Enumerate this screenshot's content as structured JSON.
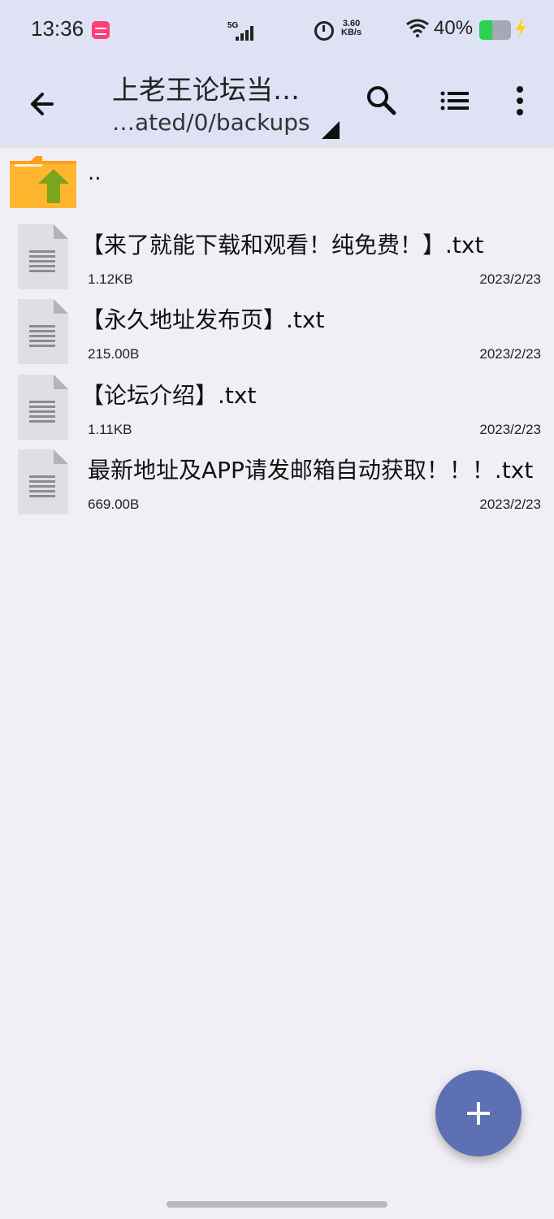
{
  "status_bar": {
    "time": "13:36",
    "net_speed_top": "3.60",
    "net_speed_bottom": "KB/s",
    "network_type": "5G",
    "battery_percent": "40%",
    "battery_level": 0.4
  },
  "app_bar": {
    "title": "上老王论坛当…",
    "path": "…ated/0/backups"
  },
  "parent_directory": "..",
  "files": [
    {
      "name": "【来了就能下载和观看！纯免费！】.txt",
      "size": "1.12KB",
      "date": "2023/2/23"
    },
    {
      "name": "【永久地址发布页】.txt",
      "size": "215.00B",
      "date": "2023/2/23"
    },
    {
      "name": "【论坛介绍】.txt",
      "size": "1.11KB",
      "date": "2023/2/23"
    },
    {
      "name": "最新地址及APP请发邮箱自动获取！！！.txt",
      "size": "669.00B",
      "date": "2023/2/23"
    }
  ],
  "colors": {
    "header": "#dfe1f4",
    "background": "#f1eff5",
    "fab": "#5c70b3",
    "folder": "#ff9f1c",
    "folder_arrow": "#7aa51d"
  },
  "icons": {
    "back": "back-arrow-icon",
    "search": "search-icon",
    "view": "list-view-icon",
    "more": "more-vert-icon",
    "parent": "folder-up-icon",
    "file": "text-file-icon",
    "fab": "add-icon"
  }
}
